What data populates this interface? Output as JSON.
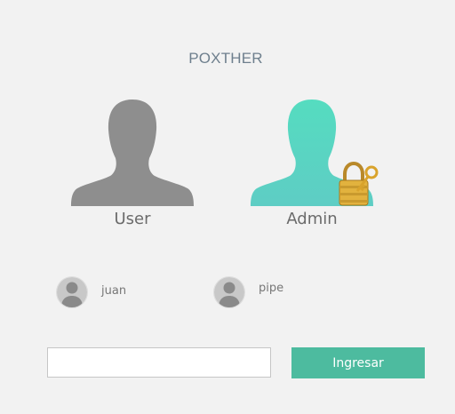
{
  "app": {
    "title": "POXTHER"
  },
  "roles": [
    {
      "label": "User",
      "icon": "user-silhouette-icon",
      "color": "#8e8e8e"
    },
    {
      "label": "Admin",
      "icon": "admin-silhouette-icon",
      "color": "#5cd3c0",
      "badge_icon": "padlock-with-key-icon"
    }
  ],
  "accounts": [
    {
      "name": "juan",
      "icon": "user-avatar-icon"
    },
    {
      "name": "pipe",
      "icon": "user-avatar-icon"
    }
  ],
  "login": {
    "password_value": "",
    "submit_label": "Ingresar",
    "submit_color": "#4dbb9f"
  }
}
